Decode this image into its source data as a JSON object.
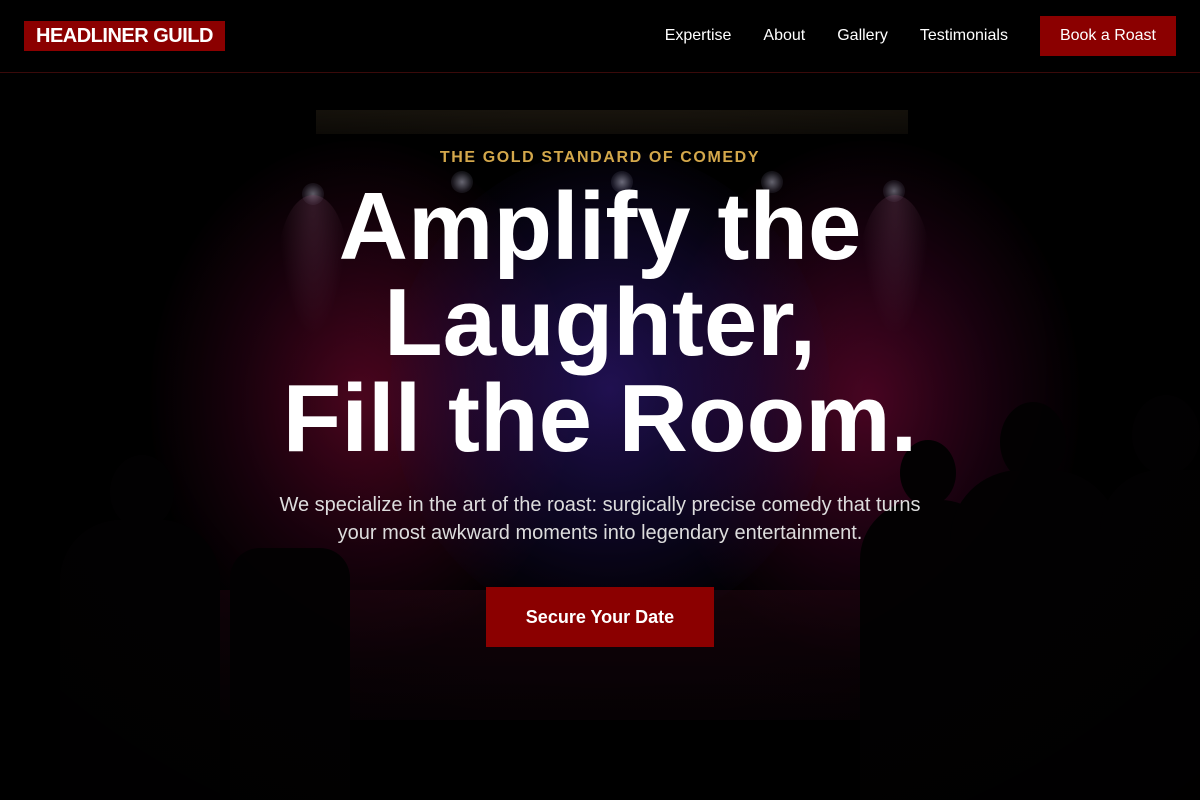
{
  "navbar": {
    "logo": "HEADLINER GUILD",
    "links": [
      "Expertise",
      "About",
      "Gallery",
      "Testimonials"
    ],
    "cta_label": "Book a Roast"
  },
  "hero": {
    "eyebrow": "THE GOLD STANDARD OF COMEDY",
    "headline_lines": [
      "Amplify the",
      "Laughter,",
      "Fill the Room."
    ],
    "subtext": "We specialize in the art of the roast: surgically precise comedy that turns your most awkward moments into legendary entertainment.",
    "cta_label": "Secure Your Date"
  },
  "colors": {
    "accent": "#8b0000",
    "eyebrow": "#d4a84b",
    "background": "#000000"
  }
}
